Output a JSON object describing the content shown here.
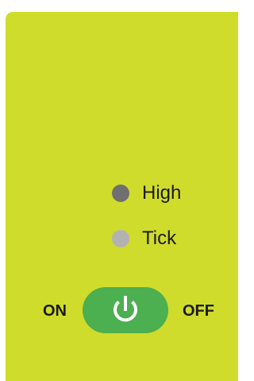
{
  "indicators": [
    {
      "label": "High",
      "color": "#707070"
    },
    {
      "label": "Tick",
      "color": "#b2b2b2"
    }
  ],
  "power": {
    "on_label": "ON",
    "off_label": "OFF",
    "button_color": "#4caf50",
    "icon": "power-icon"
  },
  "panel": {
    "background": "#d0dc2c"
  }
}
